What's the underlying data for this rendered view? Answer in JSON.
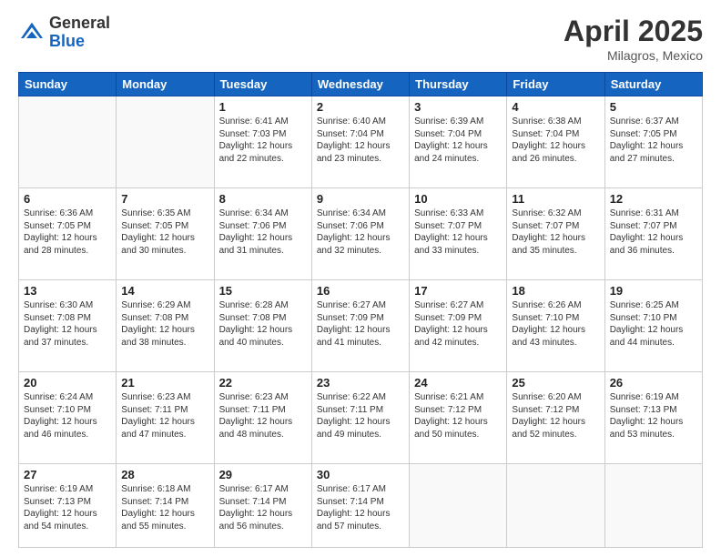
{
  "header": {
    "logo_general": "General",
    "logo_blue": "Blue",
    "month_year": "April 2025",
    "location": "Milagros, Mexico"
  },
  "weekdays": [
    "Sunday",
    "Monday",
    "Tuesday",
    "Wednesday",
    "Thursday",
    "Friday",
    "Saturday"
  ],
  "weeks": [
    [
      {
        "day": "",
        "empty": true
      },
      {
        "day": "",
        "empty": true
      },
      {
        "day": "1",
        "sunrise": "6:41 AM",
        "sunset": "7:03 PM",
        "daylight": "12 hours and 22 minutes."
      },
      {
        "day": "2",
        "sunrise": "6:40 AM",
        "sunset": "7:04 PM",
        "daylight": "12 hours and 23 minutes."
      },
      {
        "day": "3",
        "sunrise": "6:39 AM",
        "sunset": "7:04 PM",
        "daylight": "12 hours and 24 minutes."
      },
      {
        "day": "4",
        "sunrise": "6:38 AM",
        "sunset": "7:04 PM",
        "daylight": "12 hours and 26 minutes."
      },
      {
        "day": "5",
        "sunrise": "6:37 AM",
        "sunset": "7:05 PM",
        "daylight": "12 hours and 27 minutes."
      }
    ],
    [
      {
        "day": "6",
        "sunrise": "6:36 AM",
        "sunset": "7:05 PM",
        "daylight": "12 hours and 28 minutes."
      },
      {
        "day": "7",
        "sunrise": "6:35 AM",
        "sunset": "7:05 PM",
        "daylight": "12 hours and 30 minutes."
      },
      {
        "day": "8",
        "sunrise": "6:34 AM",
        "sunset": "7:06 PM",
        "daylight": "12 hours and 31 minutes."
      },
      {
        "day": "9",
        "sunrise": "6:34 AM",
        "sunset": "7:06 PM",
        "daylight": "12 hours and 32 minutes."
      },
      {
        "day": "10",
        "sunrise": "6:33 AM",
        "sunset": "7:07 PM",
        "daylight": "12 hours and 33 minutes."
      },
      {
        "day": "11",
        "sunrise": "6:32 AM",
        "sunset": "7:07 PM",
        "daylight": "12 hours and 35 minutes."
      },
      {
        "day": "12",
        "sunrise": "6:31 AM",
        "sunset": "7:07 PM",
        "daylight": "12 hours and 36 minutes."
      }
    ],
    [
      {
        "day": "13",
        "sunrise": "6:30 AM",
        "sunset": "7:08 PM",
        "daylight": "12 hours and 37 minutes."
      },
      {
        "day": "14",
        "sunrise": "6:29 AM",
        "sunset": "7:08 PM",
        "daylight": "12 hours and 38 minutes."
      },
      {
        "day": "15",
        "sunrise": "6:28 AM",
        "sunset": "7:08 PM",
        "daylight": "12 hours and 40 minutes."
      },
      {
        "day": "16",
        "sunrise": "6:27 AM",
        "sunset": "7:09 PM",
        "daylight": "12 hours and 41 minutes."
      },
      {
        "day": "17",
        "sunrise": "6:27 AM",
        "sunset": "7:09 PM",
        "daylight": "12 hours and 42 minutes."
      },
      {
        "day": "18",
        "sunrise": "6:26 AM",
        "sunset": "7:10 PM",
        "daylight": "12 hours and 43 minutes."
      },
      {
        "day": "19",
        "sunrise": "6:25 AM",
        "sunset": "7:10 PM",
        "daylight": "12 hours and 44 minutes."
      }
    ],
    [
      {
        "day": "20",
        "sunrise": "6:24 AM",
        "sunset": "7:10 PM",
        "daylight": "12 hours and 46 minutes."
      },
      {
        "day": "21",
        "sunrise": "6:23 AM",
        "sunset": "7:11 PM",
        "daylight": "12 hours and 47 minutes."
      },
      {
        "day": "22",
        "sunrise": "6:23 AM",
        "sunset": "7:11 PM",
        "daylight": "12 hours and 48 minutes."
      },
      {
        "day": "23",
        "sunrise": "6:22 AM",
        "sunset": "7:11 PM",
        "daylight": "12 hours and 49 minutes."
      },
      {
        "day": "24",
        "sunrise": "6:21 AM",
        "sunset": "7:12 PM",
        "daylight": "12 hours and 50 minutes."
      },
      {
        "day": "25",
        "sunrise": "6:20 AM",
        "sunset": "7:12 PM",
        "daylight": "12 hours and 52 minutes."
      },
      {
        "day": "26",
        "sunrise": "6:19 AM",
        "sunset": "7:13 PM",
        "daylight": "12 hours and 53 minutes."
      }
    ],
    [
      {
        "day": "27",
        "sunrise": "6:19 AM",
        "sunset": "7:13 PM",
        "daylight": "12 hours and 54 minutes."
      },
      {
        "day": "28",
        "sunrise": "6:18 AM",
        "sunset": "7:14 PM",
        "daylight": "12 hours and 55 minutes."
      },
      {
        "day": "29",
        "sunrise": "6:17 AM",
        "sunset": "7:14 PM",
        "daylight": "12 hours and 56 minutes."
      },
      {
        "day": "30",
        "sunrise": "6:17 AM",
        "sunset": "7:14 PM",
        "daylight": "12 hours and 57 minutes."
      },
      {
        "day": "",
        "empty": true
      },
      {
        "day": "",
        "empty": true
      },
      {
        "day": "",
        "empty": true
      }
    ]
  ]
}
